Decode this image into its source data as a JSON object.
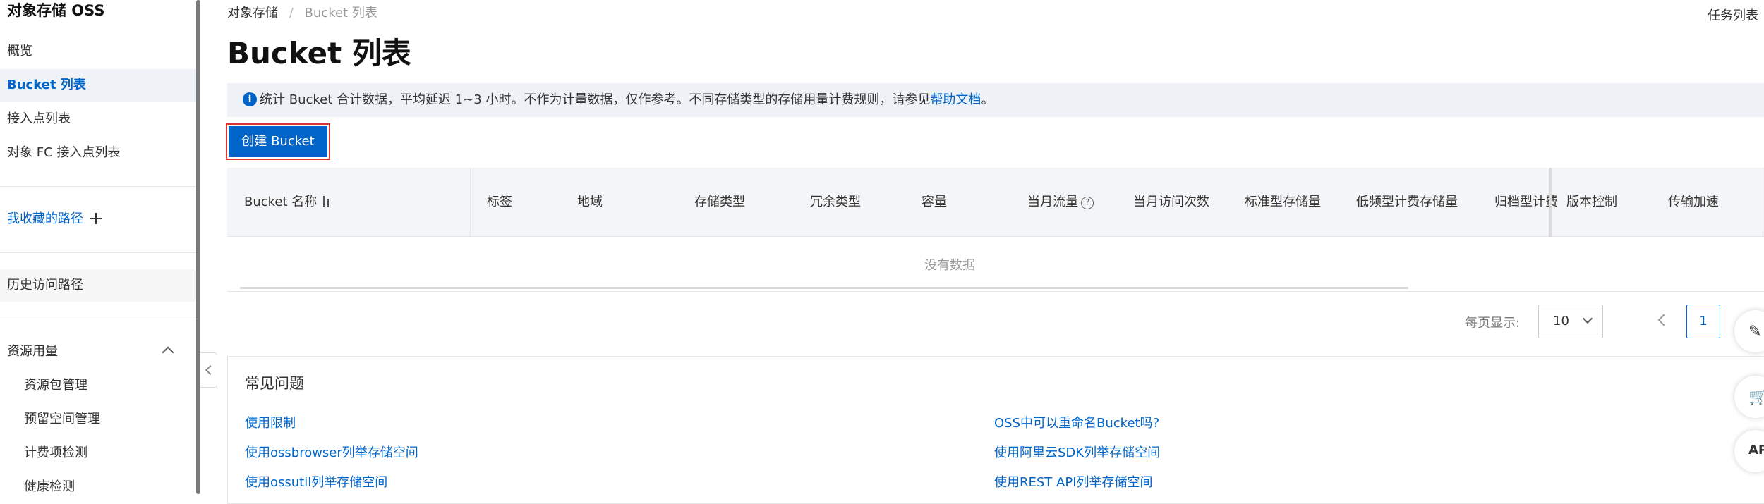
{
  "sidebar": {
    "title": "对象存储 OSS",
    "items": [
      {
        "label": "概览"
      },
      {
        "label": "Bucket 列表"
      },
      {
        "label": "接入点列表"
      },
      {
        "label": "对象 FC 接入点列表"
      }
    ],
    "favorites_label": "我收藏的路径",
    "history_label": "历史访问路径",
    "resource_group": {
      "label": "资源用量",
      "items": [
        {
          "label": "资源包管理"
        },
        {
          "label": "预留空间管理"
        },
        {
          "label": "计费项检测"
        },
        {
          "label": "健康检测"
        }
      ]
    }
  },
  "breadcrumb": {
    "root": "对象存储",
    "separator": "/",
    "current": "Bucket 列表"
  },
  "task_list_label": "任务列表",
  "page_title": "Bucket 列表",
  "notice": {
    "text": "统计 Bucket 合计数据，平均延迟 1~3 小时。不作为计量数据，仅作参考。不同存储类型的存储用量计费规则，请参见",
    "link": "帮助文档",
    "suffix": "。",
    "icon": "i"
  },
  "create_button_label": "创建 Bucket",
  "table": {
    "columns": [
      {
        "label": "Bucket 名称"
      },
      {
        "label": "标签"
      },
      {
        "label": "地域"
      },
      {
        "label": "存储类型"
      },
      {
        "label": "冗余类型"
      },
      {
        "label": "容量"
      },
      {
        "label": "当月流量"
      },
      {
        "label": "当月访问次数"
      },
      {
        "label": "标准型存储量"
      },
      {
        "label": "低频型计费存储量"
      },
      {
        "label": "归档型计费"
      },
      {
        "label": "版本控制"
      },
      {
        "label": "传输加速"
      }
    ],
    "help_glyph": "?",
    "empty_text": "没有数据"
  },
  "pagination": {
    "page_size_label": "每页显示:",
    "page_size": "10",
    "current_page": "1"
  },
  "faq": {
    "title": "常见问题",
    "links_left": [
      "使用限制",
      "使用ossbrowser列举存储空间",
      "使用ossutil列举存储空间"
    ],
    "links_right": [
      "OSS中可以重命名Bucket吗?",
      "使用阿里云SDK列举存储空间",
      "使用REST API列举存储空间"
    ]
  },
  "colors": {
    "primary": "#0064c8",
    "highlight_border": "#e0332f",
    "notice_bg": "#eef2f7",
    "table_header_bg": "#f4f5f7"
  },
  "float_tools": {
    "edit_glyph": "✎",
    "cart_glyph": "🛒",
    "api_glyph": "AP"
  }
}
